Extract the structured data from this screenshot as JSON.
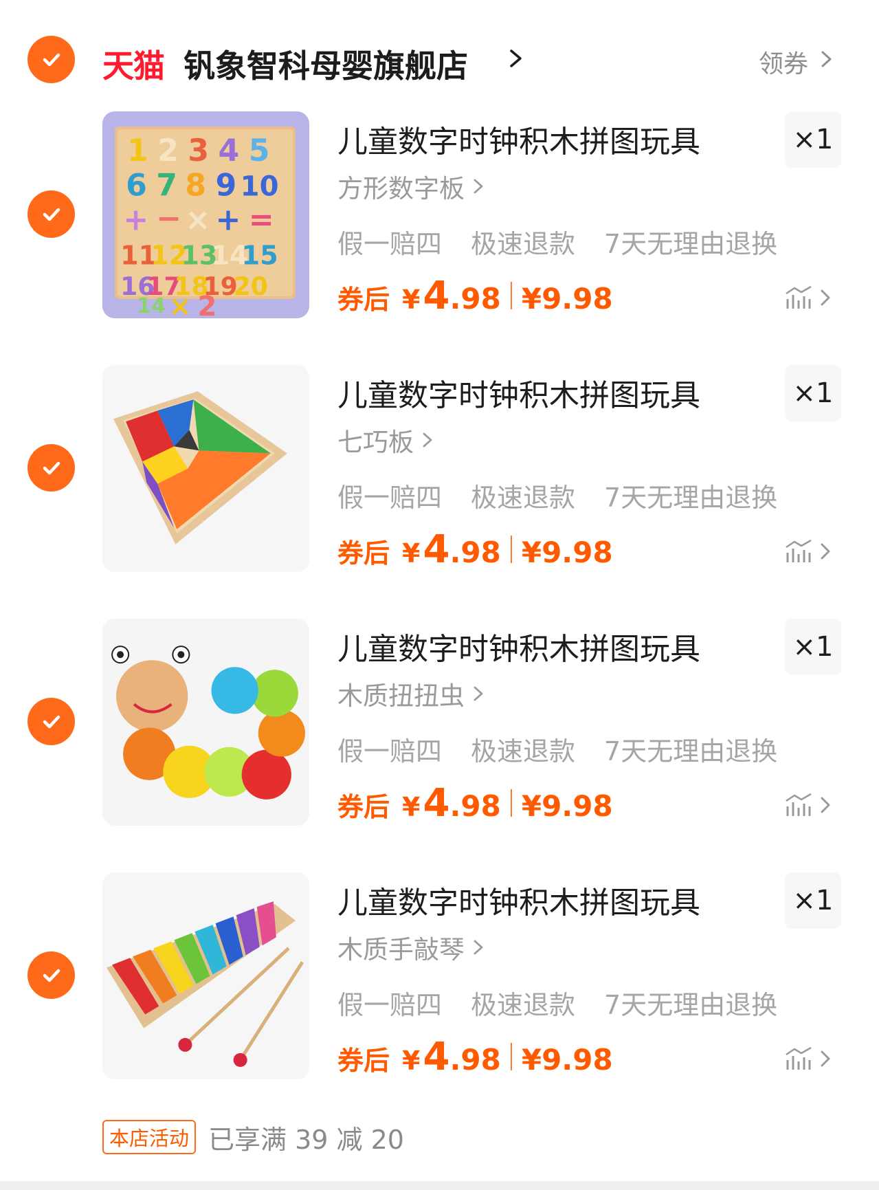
{
  "shop": {
    "platform_logo": "天猫",
    "name": "钒象智科母婴旗舰店",
    "coupon_label": "领券",
    "selected": true
  },
  "items": [
    {
      "selected": true,
      "image_icon": "number-puzzle-board-image",
      "title": "儿童数字时钟积木拼图玩具",
      "quantity": "×1",
      "spec": "方形数字板",
      "guarantees": [
        "假一赔四",
        "极速退款",
        "7天无理由退换"
      ],
      "price_label": "券后",
      "currency": "¥",
      "price_int": "4",
      "price_dec": ".98",
      "original_price": "¥9.98"
    },
    {
      "selected": true,
      "image_icon": "tangram-image",
      "title": "儿童数字时钟积木拼图玩具",
      "quantity": "×1",
      "spec": "七巧板",
      "guarantees": [
        "假一赔四",
        "极速退款",
        "7天无理由退换"
      ],
      "price_label": "券后",
      "currency": "¥",
      "price_int": "4",
      "price_dec": ".98",
      "original_price": "¥9.98"
    },
    {
      "selected": true,
      "image_icon": "wooden-caterpillar-image",
      "title": "儿童数字时钟积木拼图玩具",
      "quantity": "×1",
      "spec": "木质扭扭虫",
      "guarantees": [
        "假一赔四",
        "极速退款",
        "7天无理由退换"
      ],
      "price_label": "券后",
      "currency": "¥",
      "price_int": "4",
      "price_dec": ".98",
      "original_price": "¥9.98"
    },
    {
      "selected": true,
      "image_icon": "xylophone-image",
      "title": "儿童数字时钟积木拼图玩具",
      "quantity": "×1",
      "spec": "木质手敲琴",
      "guarantees": [
        "假一赔四",
        "极速退款",
        "7天无理由退换"
      ],
      "price_label": "券后",
      "currency": "¥",
      "price_int": "4",
      "price_dec": ".98",
      "original_price": "¥9.98"
    }
  ],
  "promo": {
    "badge": "本店活动",
    "text": "已享满 39 减 20"
  },
  "colors": {
    "accent": "#ff6a1a",
    "price": "#ff5a00",
    "tmall_red": "#ff1a2e"
  }
}
